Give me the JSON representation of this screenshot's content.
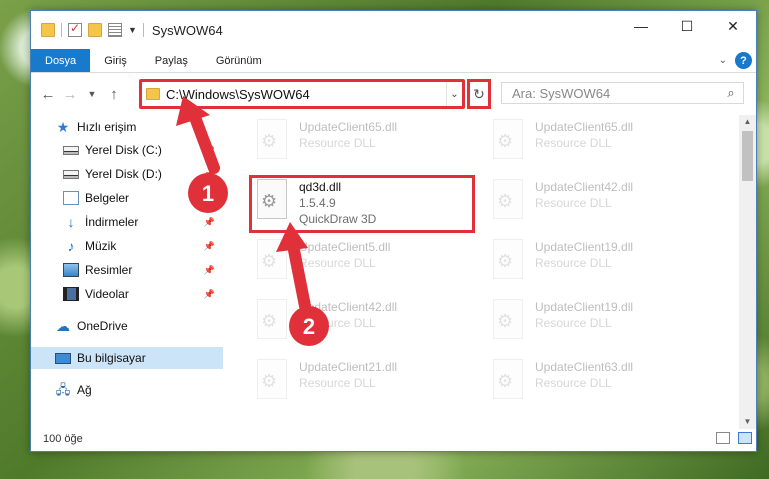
{
  "window": {
    "title": "SysWOW64"
  },
  "window_buttons": {
    "minimize": "—",
    "maximize": "☐",
    "close": "✕"
  },
  "ribbon": {
    "tabs": [
      "Dosya",
      "Giriş",
      "Paylaş",
      "Görünüm"
    ],
    "help_label": "?"
  },
  "navbar": {
    "address": "C:\\Windows\\SysWOW64",
    "search_placeholder": "Ara: SysWOW64"
  },
  "sidebar": {
    "items": [
      {
        "label": "Hızlı erişim",
        "icon": "star-icon"
      },
      {
        "label": "Yerel Disk (C:)",
        "icon": "disk-icon",
        "pinned": true
      },
      {
        "label": "Yerel Disk (D:)",
        "icon": "disk-icon",
        "pinned": true
      },
      {
        "label": "Belgeler",
        "icon": "documents-icon",
        "pinned": true
      },
      {
        "label": "İndirmeler",
        "icon": "downloads-icon",
        "pinned": true
      },
      {
        "label": "Müzik",
        "icon": "music-icon",
        "pinned": true
      },
      {
        "label": "Resimler",
        "icon": "pictures-icon",
        "pinned": true
      },
      {
        "label": "Videolar",
        "icon": "videos-icon",
        "pinned": true
      },
      {
        "label": "OneDrive",
        "icon": "cloud-icon"
      },
      {
        "label": "Bu bilgisayar",
        "icon": "computer-icon",
        "selected": true
      },
      {
        "label": "Ağ",
        "icon": "network-icon"
      }
    ]
  },
  "files": [
    {
      "name": "UpdateClient65.dll",
      "type": "Resource DLL",
      "faded": true
    },
    {
      "name": "UpdateClient65.dll",
      "type": "Resource DLL",
      "faded": true
    },
    {
      "name": "qd3d.dll",
      "version": "1.5.4.9",
      "type": "QuickDraw 3D",
      "faded": false
    },
    {
      "name": "UpdateClient42.dll",
      "type": "Resource DLL",
      "faded": true
    },
    {
      "name": "UpdateClient5.dll",
      "type": "Resource DLL",
      "faded": true
    },
    {
      "name": "UpdateClient19.dll",
      "type": "Resource DLL",
      "faded": true
    },
    {
      "name": "UpdateClient42.dll",
      "type": "Resource DLL",
      "faded": true
    },
    {
      "name": "UpdateClient19.dll",
      "type": "Resource DLL",
      "faded": true
    },
    {
      "name": "UpdateClient21.dll",
      "type": "Resource DLL",
      "faded": true
    },
    {
      "name": "UpdateClient63.dll",
      "type": "Resource DLL",
      "faded": true
    }
  ],
  "status": {
    "count": "100 öğe"
  },
  "annotations": {
    "step1": "1",
    "step2": "2",
    "accent": "#e0303a"
  }
}
